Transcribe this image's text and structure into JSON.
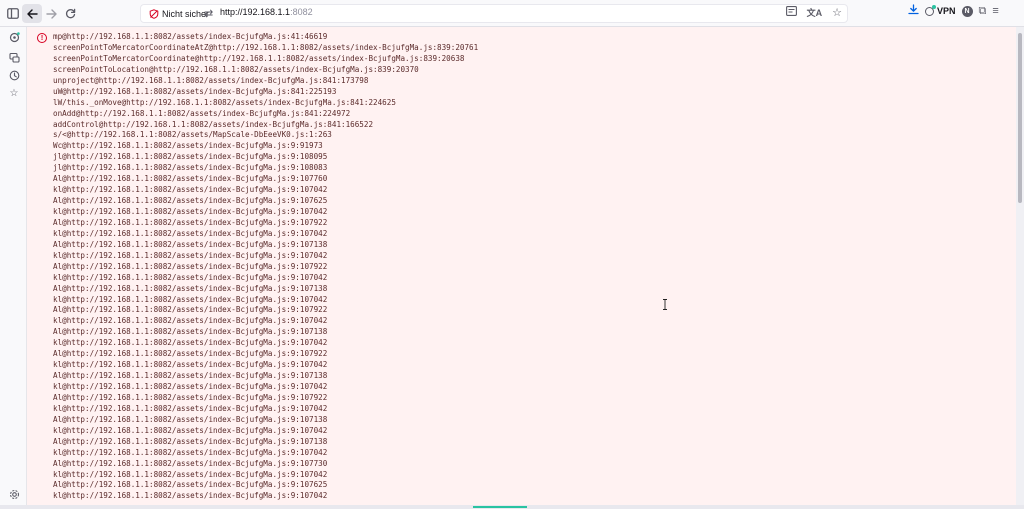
{
  "toolbar": {
    "security_label": "Nicht sicher",
    "url_host": "http://192.168.1.1",
    "url_port": ":8082",
    "vpn_label": "VPN",
    "account_initial": "N"
  },
  "error": {
    "stack": [
      "mp@http://192.168.1.1:8082/assets/index-BcjufgMa.js:41:46619",
      "screenPointToMercatorCoordinateAtZ@http://192.168.1.1:8082/assets/index-BcjufgMa.js:839:20761",
      "screenPointToMercatorCoordinate@http://192.168.1.1:8082/assets/index-BcjufgMa.js:839:20638",
      "screenPointToLocation@http://192.168.1.1:8082/assets/index-BcjufgMa.js:839:20370",
      "unproject@http://192.168.1.1:8082/assets/index-BcjufgMa.js:841:173798",
      "uW@http://192.168.1.1:8082/assets/index-BcjufgMa.js:841:225193",
      "lW/this._onMove@http://192.168.1.1:8082/assets/index-BcjufgMa.js:841:224625",
      "onAdd@http://192.168.1.1:8082/assets/index-BcjufgMa.js:841:224972",
      "addControl@http://192.168.1.1:8082/assets/index-BcjufgMa.js:841:166522",
      "s/<@http://192.168.1.1:8082/assets/MapScale-DbEeeVK0.js:1:263",
      "Wc@http://192.168.1.1:8082/assets/index-BcjufgMa.js:9:91973",
      "jl@http://192.168.1.1:8082/assets/index-BcjufgMa.js:9:108095",
      "jl@http://192.168.1.1:8082/assets/index-BcjufgMa.js:9:108083",
      "Al@http://192.168.1.1:8082/assets/index-BcjufgMa.js:9:107760",
      "kl@http://192.168.1.1:8082/assets/index-BcjufgMa.js:9:107042",
      "Al@http://192.168.1.1:8082/assets/index-BcjufgMa.js:9:107625",
      "kl@http://192.168.1.1:8082/assets/index-BcjufgMa.js:9:107042",
      "Al@http://192.168.1.1:8082/assets/index-BcjufgMa.js:9:107922",
      "kl@http://192.168.1.1:8082/assets/index-BcjufgMa.js:9:107042",
      "Al@http://192.168.1.1:8082/assets/index-BcjufgMa.js:9:107138",
      "kl@http://192.168.1.1:8082/assets/index-BcjufgMa.js:9:107042",
      "Al@http://192.168.1.1:8082/assets/index-BcjufgMa.js:9:107922",
      "kl@http://192.168.1.1:8082/assets/index-BcjufgMa.js:9:107042",
      "Al@http://192.168.1.1:8082/assets/index-BcjufgMa.js:9:107138",
      "kl@http://192.168.1.1:8082/assets/index-BcjufgMa.js:9:107042",
      "Al@http://192.168.1.1:8082/assets/index-BcjufgMa.js:9:107922",
      "kl@http://192.168.1.1:8082/assets/index-BcjufgMa.js:9:107042",
      "Al@http://192.168.1.1:8082/assets/index-BcjufgMa.js:9:107138",
      "kl@http://192.168.1.1:8082/assets/index-BcjufgMa.js:9:107042",
      "Al@http://192.168.1.1:8082/assets/index-BcjufgMa.js:9:107922",
      "kl@http://192.168.1.1:8082/assets/index-BcjufgMa.js:9:107042",
      "Al@http://192.168.1.1:8082/assets/index-BcjufgMa.js:9:107138",
      "kl@http://192.168.1.1:8082/assets/index-BcjufgMa.js:9:107042",
      "Al@http://192.168.1.1:8082/assets/index-BcjufgMa.js:9:107922",
      "kl@http://192.168.1.1:8082/assets/index-BcjufgMa.js:9:107042",
      "Al@http://192.168.1.1:8082/assets/index-BcjufgMa.js:9:107138",
      "kl@http://192.168.1.1:8082/assets/index-BcjufgMa.js:9:107042",
      "Al@http://192.168.1.1:8082/assets/index-BcjufgMa.js:9:107138",
      "kl@http://192.168.1.1:8082/assets/index-BcjufgMa.js:9:107042",
      "Al@http://192.168.1.1:8082/assets/index-BcjufgMa.js:9:107730",
      "kl@http://192.168.1.1:8082/assets/index-BcjufgMa.js:9:107042",
      "Al@http://192.168.1.1:8082/assets/index-BcjufgMa.js:9:107625",
      "kl@http://192.168.1.1:8082/assets/index-BcjufgMa.js:9:107042"
    ]
  },
  "colors": {
    "error_bg": "#fff2f2",
    "error_text": "#5b2b2b",
    "error_icon": "#d70022",
    "vpn_status": "#2ac3a2"
  }
}
